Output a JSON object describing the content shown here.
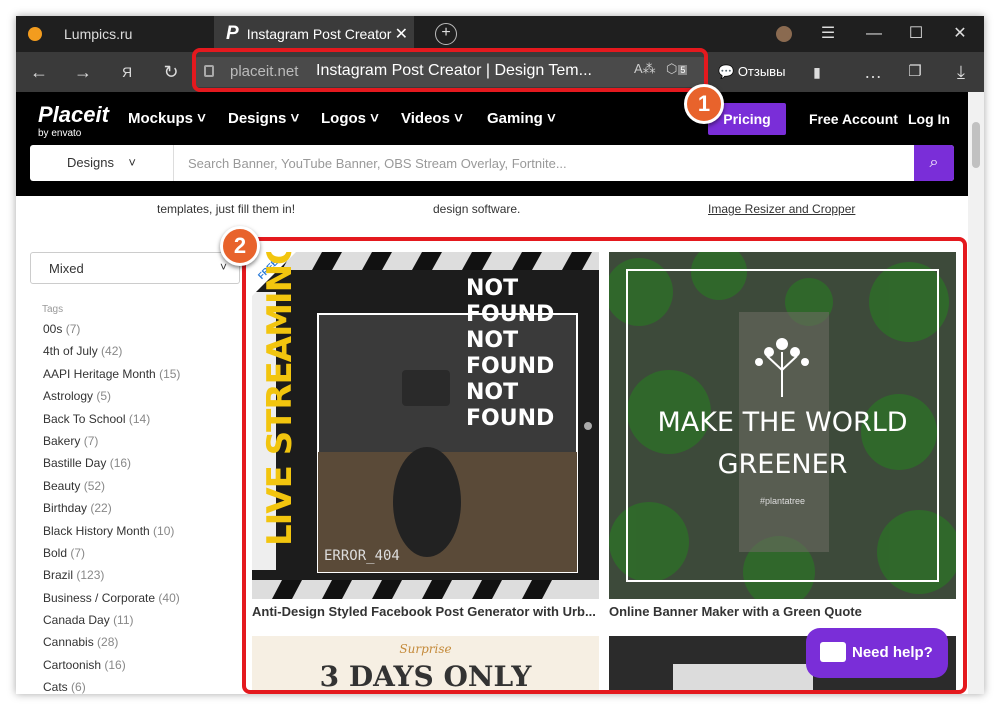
{
  "browser": {
    "tabs": [
      {
        "title": "Lumpics.ru"
      },
      {
        "title": "Instagram Post Creator"
      }
    ],
    "url_host": "placeit.net",
    "page_title": "Instagram Post Creator | Design Tem...",
    "reviews_label": "Отзывы",
    "ext_badge": "5"
  },
  "site": {
    "logo": "Placeit",
    "logo_sub": "by envato",
    "nav": [
      "Mockups",
      "Designs",
      "Logos",
      "Videos",
      "Gaming"
    ],
    "pricing": "Pricing",
    "free_account": "Free Account",
    "login": "Log In",
    "search": {
      "category": "Designs",
      "placeholder": "Search Banner, YouTube Banner, OBS Stream Overlay, Fortnite..."
    }
  },
  "promo": [
    "templates, just fill them in!",
    "design software.",
    "Image Resizer and Cropper"
  ],
  "filter": {
    "sort": "Mixed",
    "tags_heading": "Tags"
  },
  "tags": [
    {
      "name": "00s",
      "count": "(7)"
    },
    {
      "name": "4th of July",
      "count": "(42)"
    },
    {
      "name": "AAPI Heritage Month",
      "count": "(15)"
    },
    {
      "name": "Astrology",
      "count": "(5)"
    },
    {
      "name": "Back To School",
      "count": "(14)"
    },
    {
      "name": "Bakery",
      "count": "(7)"
    },
    {
      "name": "Bastille Day",
      "count": "(16)"
    },
    {
      "name": "Beauty",
      "count": "(52)"
    },
    {
      "name": "Birthday",
      "count": "(22)"
    },
    {
      "name": "Black History Month",
      "count": "(10)"
    },
    {
      "name": "Bold",
      "count": "(7)"
    },
    {
      "name": "Brazil",
      "count": "(123)"
    },
    {
      "name": "Business / Corporate",
      "count": "(40)"
    },
    {
      "name": "Canada Day",
      "count": "(11)"
    },
    {
      "name": "Cannabis",
      "count": "(28)"
    },
    {
      "name": "Cartoonish",
      "count": "(16)"
    },
    {
      "name": "Cats",
      "count": "(6)"
    }
  ],
  "cards": [
    {
      "badge": "FREE",
      "side_text": "LIVE STREAMING",
      "headline": [
        "NOT FOUND",
        "NOT FOUND",
        "NOT FOUND"
      ],
      "error": "ERROR_404",
      "caption": "Anti-Design Styled Facebook Post Generator with Urb..."
    },
    {
      "headline": [
        "MAKE THE WORLD",
        "GREENER"
      ],
      "tag": "#plantatree",
      "caption": "Online Banner Maker with a Green Quote"
    },
    {
      "script": "Surprise",
      "headline": "3 DAYS ONLY"
    }
  ],
  "help": "Need help?",
  "annotations": [
    "1",
    "2"
  ],
  "colors": {
    "accent": "#7a2ed8",
    "annotation_red": "#e4191e",
    "badge_orange": "#e8632c"
  }
}
